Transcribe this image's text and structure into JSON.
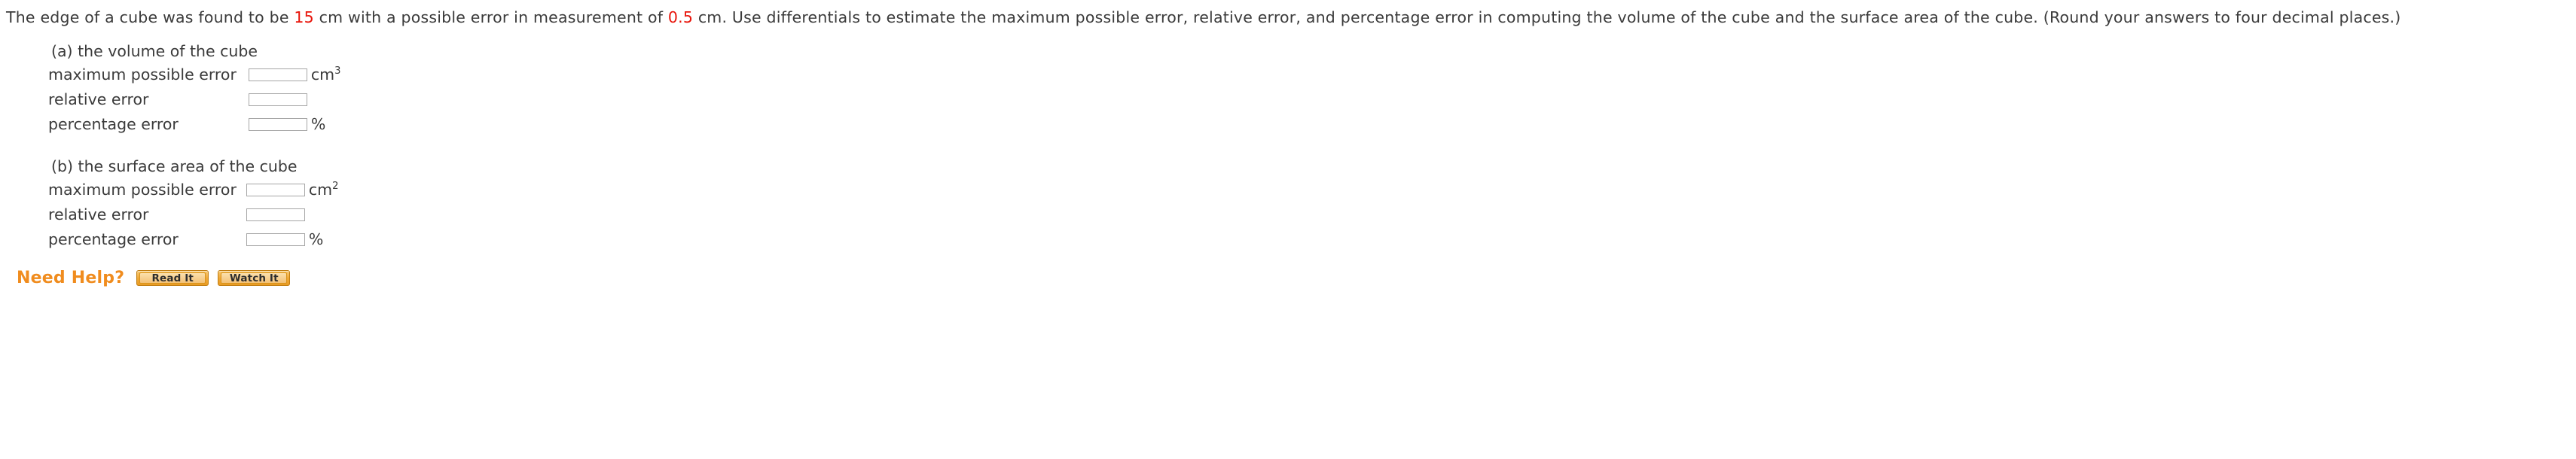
{
  "problem": {
    "text_part_1": "The edge of a cube was found to be ",
    "value_edge": "15",
    "text_part_2": " cm with a possible error in measurement of ",
    "value_error": "0.5",
    "text_part_3": " cm. Use differentials to estimate the maximum possible error, relative error, and percentage error in computing the volume of the cube and the surface area of the cube. (Round your answers to four decimal places.)",
    "highlight_color": "#e8140a"
  },
  "parts": [
    {
      "title": "(a) the volume of the cube",
      "rows": [
        {
          "label": "maximum possible error",
          "value": "",
          "unit": "cm",
          "exponent": "3"
        },
        {
          "label": "relative error",
          "value": "",
          "unit": "",
          "exponent": ""
        },
        {
          "label": "percentage error",
          "value": "",
          "unit": "%",
          "exponent": ""
        }
      ]
    },
    {
      "title": "(b) the surface area of the cube",
      "rows": [
        {
          "label": "maximum possible error",
          "value": "",
          "unit": "cm",
          "exponent": "2"
        },
        {
          "label": "relative error",
          "value": "",
          "unit": "",
          "exponent": ""
        },
        {
          "label": "percentage error",
          "value": "",
          "unit": "%",
          "exponent": ""
        }
      ]
    }
  ],
  "need_help": {
    "label": "Need Help?",
    "label_color": "#f08c1e",
    "buttons": [
      {
        "label": "Read It"
      },
      {
        "label": "Watch It"
      }
    ]
  }
}
